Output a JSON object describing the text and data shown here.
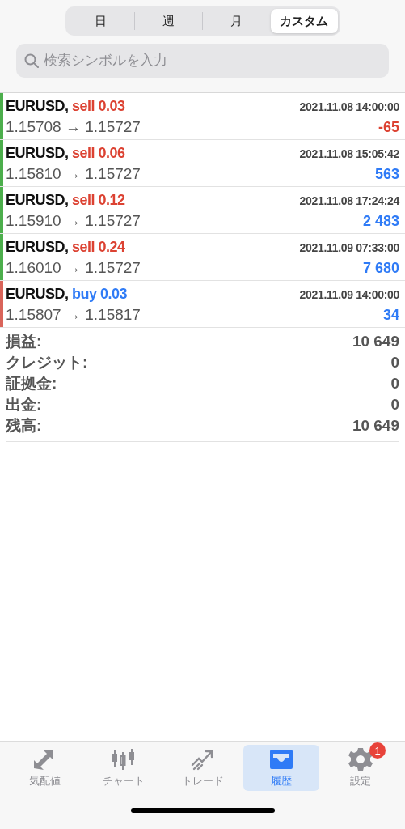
{
  "period_tabs": [
    {
      "label": "日",
      "selected": false
    },
    {
      "label": "週",
      "selected": false
    },
    {
      "label": "月",
      "selected": false
    },
    {
      "label": "カスタム",
      "selected": true
    }
  ],
  "search": {
    "placeholder": "検索シンボルを入力"
  },
  "deals": [
    {
      "symbol": "EURUSD,",
      "kind": "sell",
      "order": "sell 0.03",
      "time": "2021.11.08 14:00:00",
      "prices": "1.15708 → 1.15727",
      "profit": "-65",
      "loss": true
    },
    {
      "symbol": "EURUSD,",
      "kind": "sell",
      "order": "sell 0.06",
      "time": "2021.11.08 15:05:42",
      "prices": "1.15810 → 1.15727",
      "profit": "563",
      "loss": false
    },
    {
      "symbol": "EURUSD,",
      "kind": "sell",
      "order": "sell 0.12",
      "time": "2021.11.08 17:24:24",
      "prices": "1.15910 → 1.15727",
      "profit": "2 483",
      "loss": false
    },
    {
      "symbol": "EURUSD,",
      "kind": "sell",
      "order": "sell 0.24",
      "time": "2021.11.09 07:33:00",
      "prices": "1.16010 → 1.15727",
      "profit": "7 680",
      "loss": false
    },
    {
      "symbol": "EURUSD,",
      "kind": "buy",
      "order": "buy 0.03",
      "time": "2021.11.09 14:00:00",
      "prices": "1.15807 → 1.15817",
      "profit": "34",
      "loss": false
    }
  ],
  "summary": [
    {
      "label": "損益:",
      "value": "10 649"
    },
    {
      "label": "クレジット:",
      "value": "0"
    },
    {
      "label": "証拠金:",
      "value": "0"
    },
    {
      "label": "出金:",
      "value": "0"
    },
    {
      "label": "残高:",
      "value": "10 649"
    }
  ],
  "tab_bar": [
    {
      "kind": "quotes",
      "label": "気配値",
      "selected": false
    },
    {
      "kind": "chart",
      "label": "チャート",
      "selected": false
    },
    {
      "kind": "trade",
      "label": "トレード",
      "selected": false
    },
    {
      "kind": "history",
      "label": "履歴",
      "selected": true
    },
    {
      "kind": "settings",
      "label": "設定",
      "selected": false,
      "badge": "1"
    }
  ]
}
